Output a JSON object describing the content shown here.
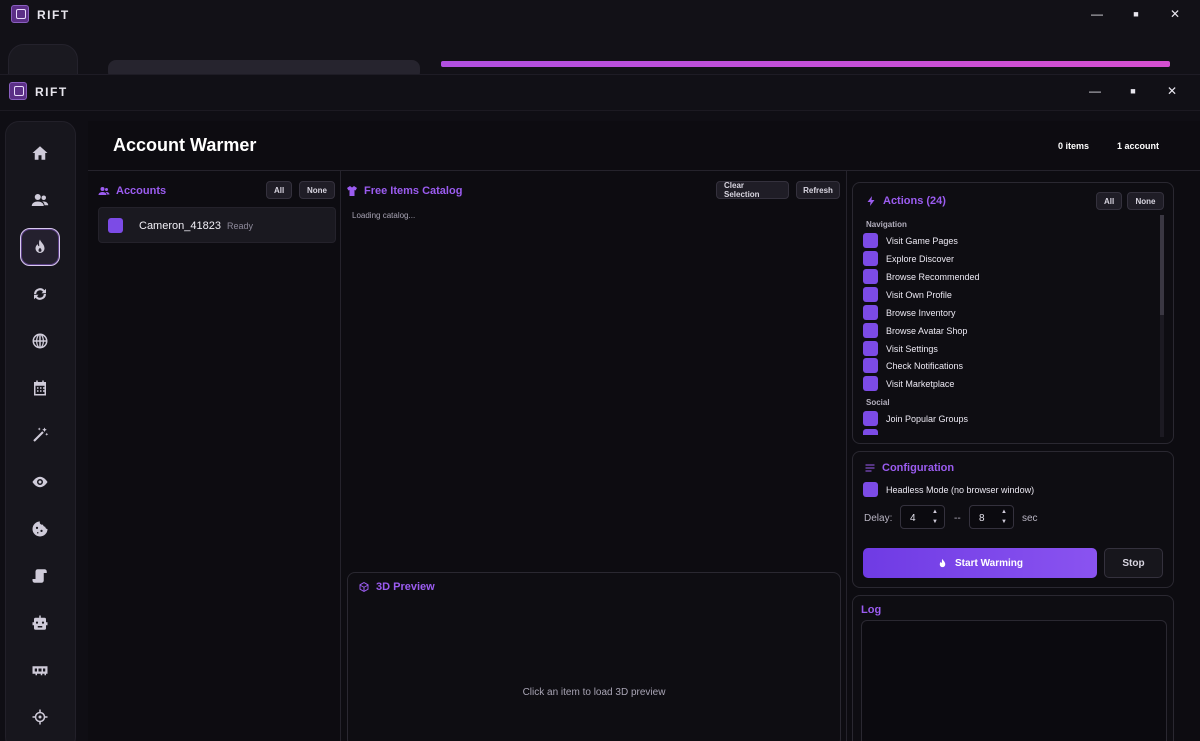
{
  "app": {
    "name": "RIFT",
    "minimize": "—",
    "maximize": "■",
    "close": "✕"
  },
  "header": {
    "title": "Account Warmer",
    "items_count": "0 items",
    "accounts_count": "1 account"
  },
  "sidebar": {
    "items": [
      {
        "name": "home-icon"
      },
      {
        "name": "users-icon"
      },
      {
        "name": "fire-icon",
        "active": true
      },
      {
        "name": "sync-icon"
      },
      {
        "name": "globe-icon"
      },
      {
        "name": "calendar-icon"
      },
      {
        "name": "magic-wand-icon"
      },
      {
        "name": "eye-icon"
      },
      {
        "name": "cookie-icon"
      },
      {
        "name": "scroll-icon"
      },
      {
        "name": "robot-icon"
      },
      {
        "name": "memory-icon"
      },
      {
        "name": "crosshair-icon"
      }
    ]
  },
  "accounts": {
    "title": "Accounts",
    "all_label": "All",
    "none_label": "None",
    "list": [
      {
        "name": "Cameron_41823",
        "status": "Ready",
        "checked": true
      }
    ]
  },
  "catalog": {
    "title": "Free Items Catalog",
    "clear_label": "Clear Selection",
    "refresh_label": "Refresh",
    "loading_text": "Loading catalog..."
  },
  "preview": {
    "title": "3D Preview",
    "hint": "Click an item to load 3D preview"
  },
  "actions": {
    "title": "Actions (24)",
    "all_label": "All",
    "none_label": "None",
    "sections": [
      {
        "label": "Navigation",
        "items": [
          "Visit Game Pages",
          "Explore Discover",
          "Browse Recommended",
          "Visit Own Profile",
          "Browse Inventory",
          "Browse Avatar Shop",
          "Visit Settings",
          "Check Notifications",
          "Visit Marketplace"
        ]
      },
      {
        "label": "Social",
        "items": [
          "Join Popular Groups"
        ]
      }
    ]
  },
  "config": {
    "title": "Configuration",
    "headless_label": "Headless Mode (no browser window)",
    "delay_label": "Delay:",
    "delay_min": "4",
    "delay_sep": "--",
    "delay_max": "8",
    "delay_unit": "sec",
    "start_label": "Start Warming",
    "stop_label": "Stop"
  },
  "log": {
    "title": "Log"
  },
  "colors": {
    "accent": "#9b5cf0",
    "checkbox": "#7c4be6",
    "progress": "#c24fd8"
  }
}
